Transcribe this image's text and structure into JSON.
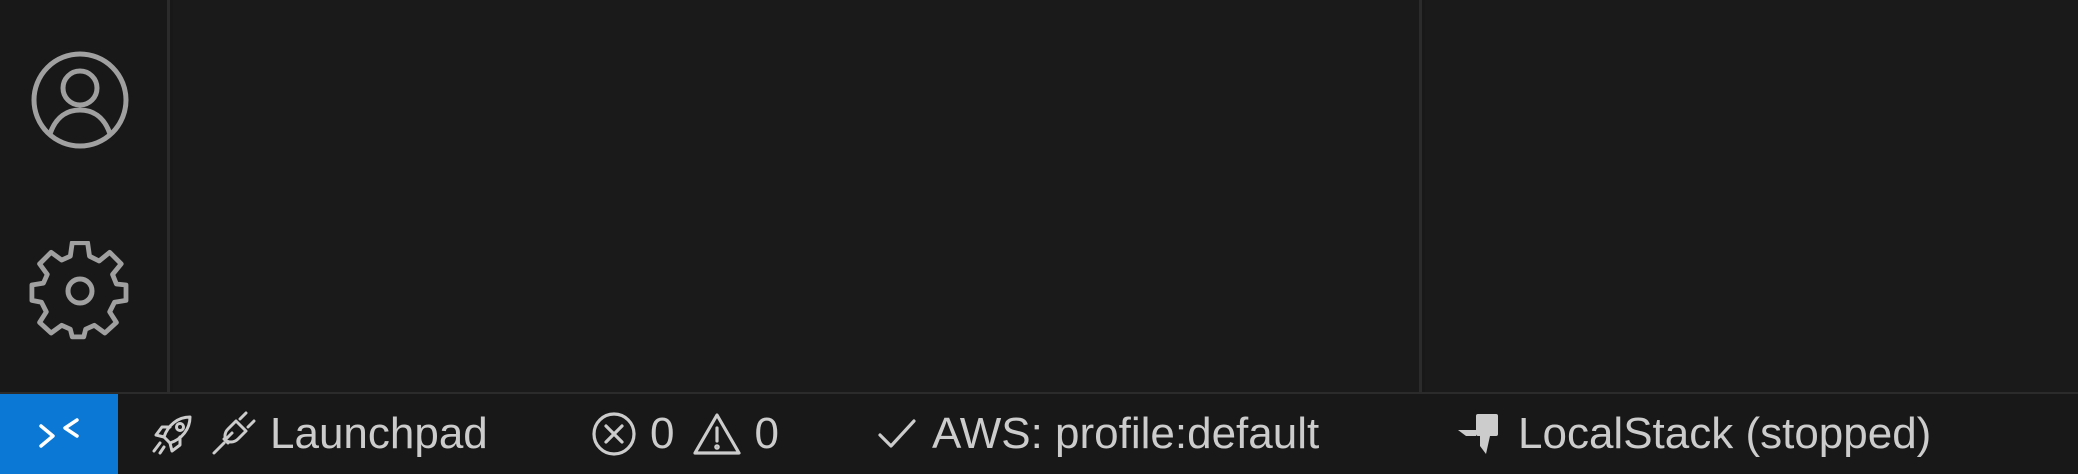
{
  "activity_bar": {
    "icons": [
      "account-icon",
      "gear-icon"
    ]
  },
  "status_bar": {
    "remote_icon": "remote-indicator-icon",
    "launchpad": {
      "icons": [
        "rocket-icon",
        "plug-icon"
      ],
      "label": "Launchpad"
    },
    "problems": {
      "errors": "0",
      "warnings": "0"
    },
    "aws": {
      "icon": "check-icon",
      "label": "AWS: profile:default"
    },
    "localstack": {
      "icon": "localstack-icon",
      "label": "LocalStack (stopped)"
    }
  },
  "colors": {
    "remote_indicator_bg": "#0a78d4",
    "background": "#181818",
    "foreground": "#cccccc"
  }
}
